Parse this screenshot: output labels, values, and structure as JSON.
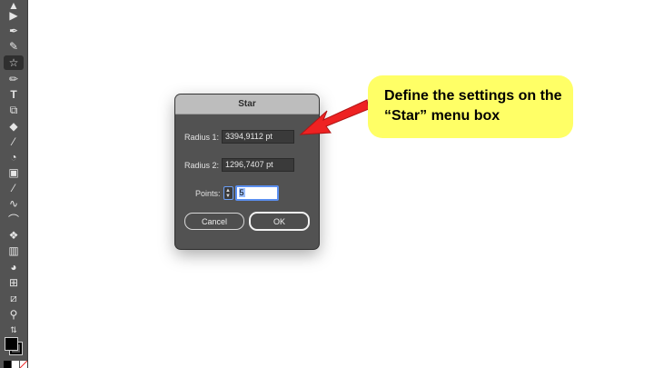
{
  "toolbar": {
    "tools": [
      {
        "name": "selection-tool-icon",
        "glyph": "▶"
      },
      {
        "name": "pen-tool-icon",
        "glyph": "✒"
      },
      {
        "name": "curvature-tool-icon",
        "glyph": "✎"
      },
      {
        "name": "star-tool-icon",
        "glyph": "☆",
        "active": true
      },
      {
        "name": "paintbrush-tool-icon",
        "glyph": "✏"
      },
      {
        "name": "type-tool-icon",
        "glyph": "T"
      },
      {
        "name": "scale-tool-icon",
        "glyph": "⧉"
      },
      {
        "name": "eraser-tool-icon",
        "glyph": "◆"
      },
      {
        "name": "eyedropper-tool-icon",
        "glyph": "⁄"
      },
      {
        "name": "shape-builder-tool-icon",
        "glyph": "◔"
      },
      {
        "name": "gradient-tool-icon",
        "glyph": "▣"
      },
      {
        "name": "eyedropper-tool-2-icon",
        "glyph": "⁄"
      },
      {
        "name": "blend-tool-icon",
        "glyph": "∿"
      },
      {
        "name": "arc-tool-icon",
        "glyph": "⌒"
      },
      {
        "name": "symbol-sprayer-tool-icon",
        "glyph": "❖"
      },
      {
        "name": "column-graph-tool-icon",
        "glyph": "▥"
      },
      {
        "name": "pie-graph-tool-icon",
        "glyph": "◕"
      },
      {
        "name": "artboard-tool-icon",
        "glyph": "⊞"
      },
      {
        "name": "slice-tool-icon",
        "glyph": "⧄"
      },
      {
        "name": "zoom-tool-icon",
        "glyph": "⚲"
      },
      {
        "name": "swap-fill-stroke-icon",
        "glyph": "⇅"
      }
    ],
    "fill_color": "#000000",
    "stroke_color": "#000000"
  },
  "dialog": {
    "title": "Star",
    "radius1_label": "Radius 1:",
    "radius1_value": "3394,9112 pt",
    "radius2_label": "Radius 2:",
    "radius2_value": "1296,7407 pt",
    "points_label": "Points:",
    "points_value": "5",
    "cancel_label": "Cancel",
    "ok_label": "OK"
  },
  "callout": {
    "text": "Define the settings on the “Star” menu box",
    "background": "#ffff66",
    "arrow_color": "#ee2222"
  }
}
